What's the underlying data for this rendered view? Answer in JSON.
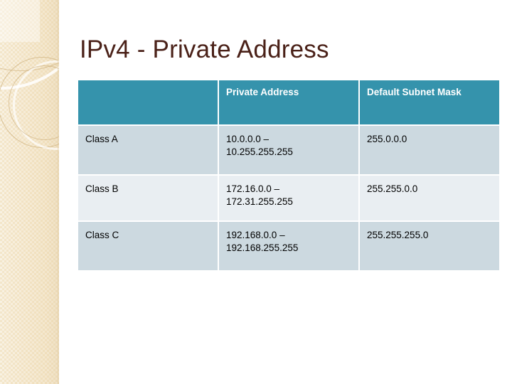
{
  "slide": {
    "title": "IPv4 - Private Address",
    "title_color": "#4a2118",
    "background_color": "#ffffff",
    "sidebar_color": "#f2e3c4"
  },
  "table": {
    "header_bg": "#3593ac",
    "header_text_color": "#ffffff",
    "row_bg_dark": "#ccd9e0",
    "row_bg_light": "#e9eef2",
    "headers": [
      "",
      "Private Address",
      "Default Subnet Mask"
    ],
    "rows": [
      {
        "label": "Class A",
        "range_start": "10.0.0.0 –",
        "range_end": "10.255.255.255",
        "mask": "255.0.0.0"
      },
      {
        "label": "Class B",
        "range_start": "172.16.0.0 –",
        "range_end": "172.31.255.255",
        "mask": "255.255.0.0"
      },
      {
        "label": "Class C",
        "range_start": "192.168.0.0 –",
        "range_end": "192.168.255.255",
        "mask": "255.255.255.0"
      }
    ]
  }
}
